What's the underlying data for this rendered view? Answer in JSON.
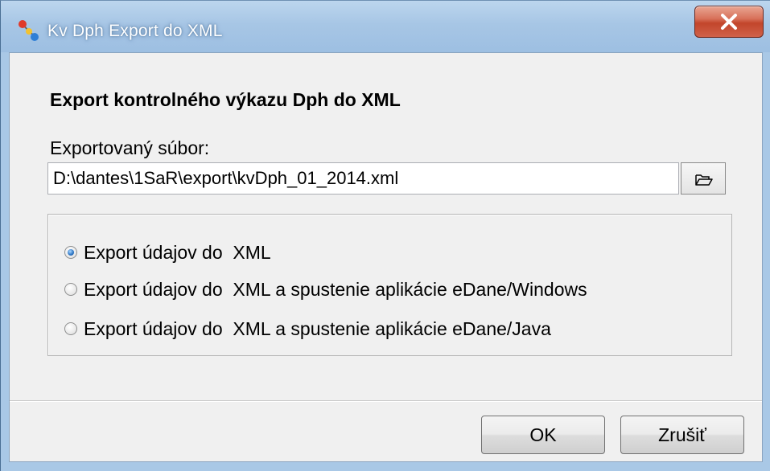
{
  "window": {
    "title": "Kv Dph Export do XML",
    "close_label": "X"
  },
  "dialog": {
    "heading": "Export kontrolného výkazu Dph do XML",
    "file_label": "Exportovaný súbor:",
    "file_value": "D:\\dantes\\1SaR\\export\\kvDph_01_2014.xml",
    "options": [
      {
        "label": "Export údajov do  XML",
        "checked": true
      },
      {
        "label": "Export údajov do  XML a spustenie aplikácie eDane/Windows",
        "checked": false
      },
      {
        "label": "Export údajov do  XML a spustenie aplikácie eDane/Java",
        "checked": false
      }
    ],
    "ok_label": "OK",
    "cancel_label": "Zrušiť"
  },
  "icons": {
    "app": "molecule-icon",
    "close": "close-icon",
    "browse": "open-folder-icon"
  },
  "colors": {
    "titlebar": "#a9c8e6",
    "close_button": "#c94a33",
    "client_background": "#f0f0f0",
    "radio_selected": "#2a73c2"
  }
}
